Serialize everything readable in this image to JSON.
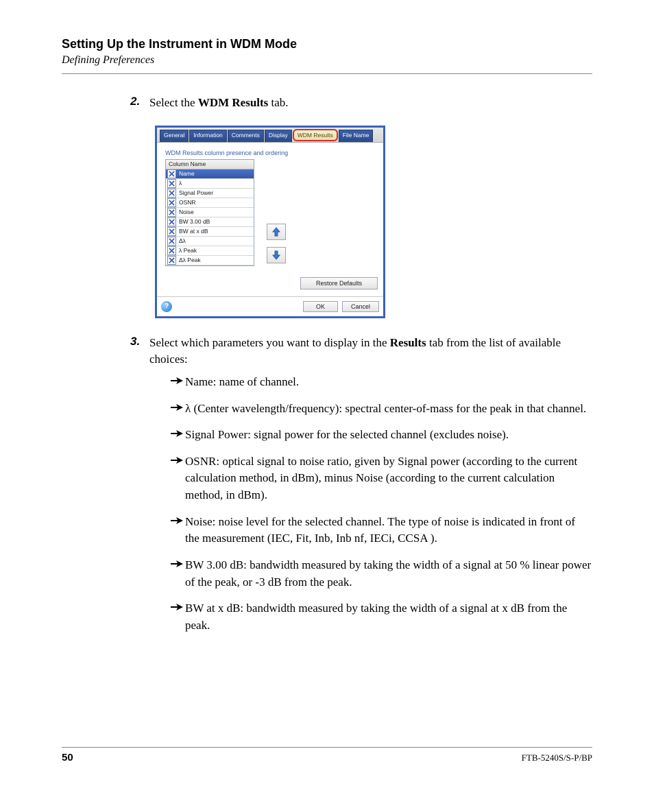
{
  "header": {
    "title": "Setting Up the Instrument in WDM Mode",
    "subtitle": "Defining Preferences"
  },
  "steps": {
    "s2": {
      "num": "2.",
      "pre": "Select the ",
      "bold": "WDM Results",
      "post": " tab."
    },
    "s3": {
      "num": "3.",
      "pre": "Select which parameters you want to display in the ",
      "bold": "Results",
      "post": " tab from the list of available choices:"
    }
  },
  "app": {
    "tabs": [
      "General",
      "Information",
      "Comments",
      "Display",
      "WDM Results",
      "File Name"
    ],
    "group_title": "WDM Results column presence and ordering",
    "col_header": "Column Name",
    "rows": [
      "Name",
      "λ",
      "Signal Power",
      "OSNR",
      "Noise",
      "BW 3.00 dB",
      "BW at x dB",
      "Δλ",
      "λ Peak",
      "Δλ Peak"
    ],
    "restore": "Restore Defaults",
    "ok": "OK",
    "cancel": "Cancel"
  },
  "bullets": [
    "Name: name of channel.",
    "λ (Center wavelength/frequency): spectral center-of-mass for the peak in that channel.",
    "Signal Power: signal power for the selected channel (excludes noise).",
    "OSNR: optical signal to noise ratio, given by Signal power (according to the current calculation method, in dBm), minus Noise (according to the current calculation method, in dBm).",
    "Noise: noise level for the selected channel. The type of noise is indicated in front of the measurement (IEC, Fit, Inb, Inb nf, IECi, CCSA ).",
    "BW 3.00 dB: bandwidth measured by taking the width of a signal at 50 % linear power of the peak, or -3 dB from the peak.",
    "BW at x dB: bandwidth measured by taking the width of a signal at x dB from the peak."
  ],
  "footer": {
    "page": "50",
    "model": "FTB-5240S/S-P/BP"
  }
}
